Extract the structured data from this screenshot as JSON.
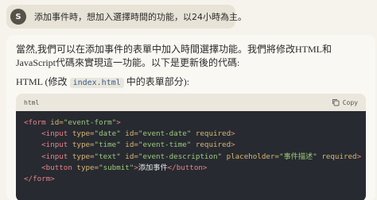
{
  "user_message": {
    "avatar_letter": "S",
    "text": "添加事件時，想加入選擇時間的功能，以24小時為主。"
  },
  "assistant": {
    "paragraph": "當然,我們可以在添加事件的表單中加入時間選擇功能。我們將修改HTML和JavaScript代碼來實現這一功能。以下是更新後的代碼:",
    "subhead_prefix": "HTML (修改 ",
    "subhead_code": "index.html",
    "subhead_suffix": " 中的表單部分):",
    "code_block": {
      "language": "html",
      "copy_label": "Copy",
      "lines": [
        [
          {
            "t": "tag",
            "v": "<form "
          },
          {
            "t": "attr",
            "v": "id="
          },
          {
            "t": "str",
            "v": "\"event-form\""
          },
          {
            "t": "tag",
            "v": ">"
          }
        ],
        [
          {
            "t": "txt",
            "v": "    "
          },
          {
            "t": "tag",
            "v": "<input "
          },
          {
            "t": "attr",
            "v": "type="
          },
          {
            "t": "str",
            "v": "\"date\""
          },
          {
            "t": "txt",
            "v": " "
          },
          {
            "t": "attr",
            "v": "id="
          },
          {
            "t": "str",
            "v": "\"event-date\""
          },
          {
            "t": "txt",
            "v": " "
          },
          {
            "t": "attr",
            "v": "required"
          },
          {
            "t": "tag",
            "v": ">"
          }
        ],
        [
          {
            "t": "txt",
            "v": "    "
          },
          {
            "t": "tag",
            "v": "<input "
          },
          {
            "t": "attr",
            "v": "type="
          },
          {
            "t": "str",
            "v": "\"time\""
          },
          {
            "t": "txt",
            "v": " "
          },
          {
            "t": "attr",
            "v": "id="
          },
          {
            "t": "str",
            "v": "\"event-time\""
          },
          {
            "t": "txt",
            "v": " "
          },
          {
            "t": "attr",
            "v": "required"
          },
          {
            "t": "tag",
            "v": ">"
          }
        ],
        [
          {
            "t": "txt",
            "v": "    "
          },
          {
            "t": "tag",
            "v": "<input "
          },
          {
            "t": "attr",
            "v": "type="
          },
          {
            "t": "str",
            "v": "\"text\""
          },
          {
            "t": "txt",
            "v": " "
          },
          {
            "t": "attr",
            "v": "id="
          },
          {
            "t": "str",
            "v": "\"event-description\""
          },
          {
            "t": "txt",
            "v": " "
          },
          {
            "t": "attr",
            "v": "placeholder="
          },
          {
            "t": "str",
            "v": "\"事件描述\""
          },
          {
            "t": "txt",
            "v": " "
          },
          {
            "t": "attr",
            "v": "required"
          },
          {
            "t": "tag",
            "v": ">"
          }
        ],
        [
          {
            "t": "txt",
            "v": "    "
          },
          {
            "t": "tag",
            "v": "<button "
          },
          {
            "t": "attr",
            "v": "type="
          },
          {
            "t": "str",
            "v": "\"submit\""
          },
          {
            "t": "tag",
            "v": ">"
          },
          {
            "t": "txt",
            "v": "添加事件"
          },
          {
            "t": "tag",
            "v": "</button>"
          }
        ],
        [
          {
            "t": "tag",
            "v": "</form>"
          }
        ]
      ]
    }
  }
}
